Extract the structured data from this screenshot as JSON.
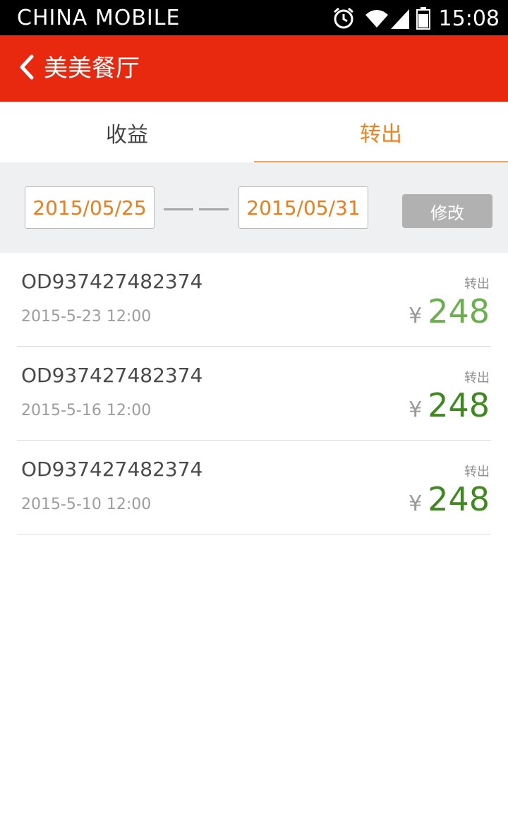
{
  "status_bar": {
    "carrier": "CHINA  MOBILE",
    "time": "15:08"
  },
  "header": {
    "title": "美美餐厅"
  },
  "tabs": [
    {
      "label": "收益"
    },
    {
      "label": "转出"
    }
  ],
  "filter": {
    "start_date": "2015/05/25",
    "end_date": "2015/05/31",
    "edit_label": "修改"
  },
  "orders": [
    {
      "id": "OD937427482374",
      "time": "2015-5-23  12:00",
      "type": "转出",
      "currency": "¥",
      "amount": "248",
      "amount_color": "#6ab04c"
    },
    {
      "id": "OD937427482374",
      "time": "2015-5-16  12:00",
      "type": "转出",
      "currency": "¥",
      "amount": "248",
      "amount_color": "#3f8a1f"
    },
    {
      "id": "OD937427482374",
      "time": "2015-5-10  12:00",
      "type": "转出",
      "currency": "¥",
      "amount": "248",
      "amount_color": "#3f8a1f"
    }
  ],
  "colors": {
    "header_bg": "#e8290f",
    "accent": "#f0821d"
  }
}
